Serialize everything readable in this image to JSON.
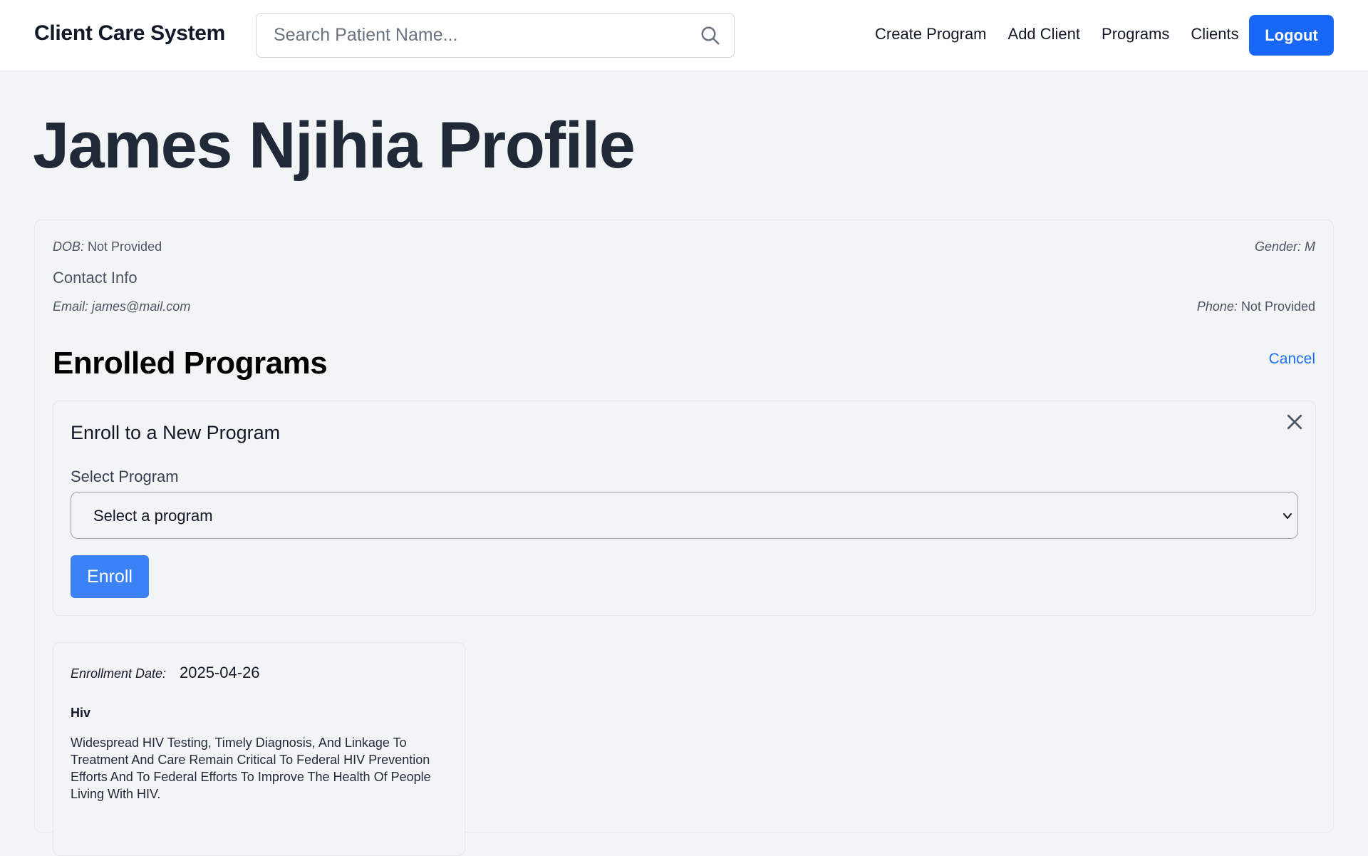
{
  "app": {
    "brand": "Client Care System",
    "search_placeholder": "Search Patient Name...",
    "nav": [
      "Create Program",
      "Add Client",
      "Programs",
      "Clients"
    ],
    "logout": "Logout",
    "accent_color": "#1867f7"
  },
  "profile": {
    "title": "James Njihia Profile",
    "dob_label": "DOB:",
    "dob_value": "Not Provided",
    "gender": "Gender: M",
    "contact_heading": "Contact Info",
    "email": "Email: james@mail.com",
    "phone_label": "Phone:",
    "phone_value": "Not Provided"
  },
  "programs": {
    "heading": "Enrolled Programs",
    "cancel": "Cancel",
    "enroll_form": {
      "title": "Enroll to a New Program",
      "select_label": "Select Program",
      "select_value": "Select a program",
      "enroll_button": "Enroll",
      "close_icon": "close-icon"
    },
    "enrollments": [
      {
        "date_label": "Enrollment Date:",
        "date": "2025-04-26",
        "name": "Hiv",
        "description": "Widespread HIV Testing, Timely Diagnosis, And Linkage To Treatment And Care Remain Critical To Federal HIV Prevention Efforts And To Federal Efforts To Improve The Health Of People Living With HIV."
      }
    ]
  }
}
